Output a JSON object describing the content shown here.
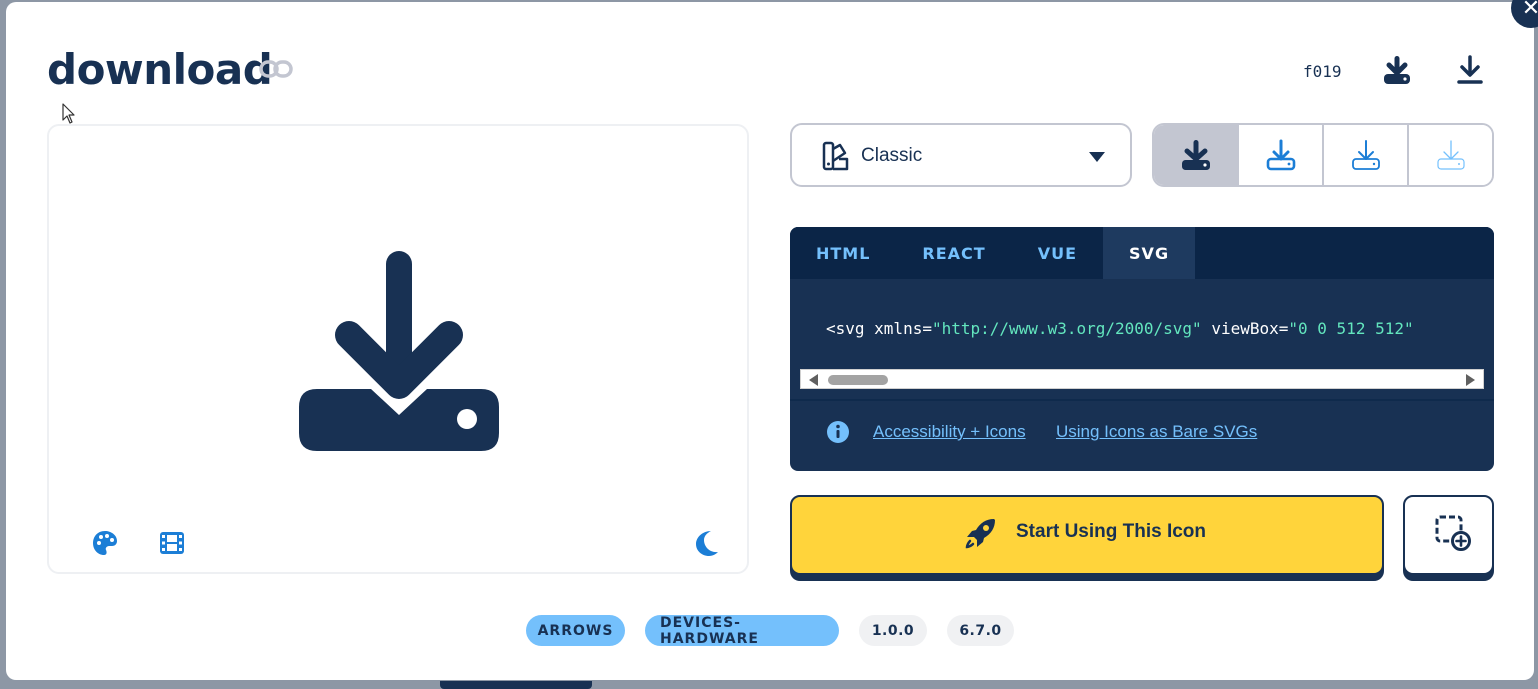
{
  "icon": {
    "name": "download",
    "unicode": "f019"
  },
  "style_select": {
    "selected": "Classic"
  },
  "code": {
    "tabs": [
      {
        "label": "HTML"
      },
      {
        "label": "REACT"
      },
      {
        "label": "VUE"
      },
      {
        "label": "SVG",
        "active": true
      }
    ],
    "line_prefix": "<svg xmlns=",
    "line_url": "\"http://www.w3.org/2000/svg\"",
    "line_attr": " viewBox=",
    "line_viewbox": "\"0 0 512 512\"",
    "links": [
      "Accessibility + Icons",
      "Using Icons as Bare SVGs"
    ]
  },
  "cta": {
    "label": "Start Using This Icon"
  },
  "tags": {
    "categories": [
      "ARROWS",
      "DEVICES-HARDWARE"
    ],
    "versions": [
      "1.0.0",
      "6.7.0"
    ]
  },
  "colors": {
    "navy": "#183153",
    "accent_yellow": "#ffd43b",
    "accent_blue": "#74c0fc",
    "code_green": "#63e6be",
    "icon_blue": "#1c7ed6"
  }
}
